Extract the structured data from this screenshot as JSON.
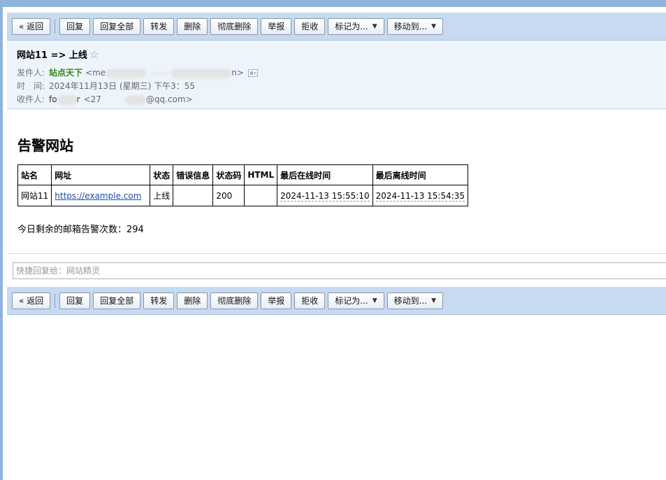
{
  "toolbar": {
    "back": "« 返回",
    "reply": "回复",
    "reply_all": "回复全部",
    "forward": "转发",
    "delete": "删除",
    "delete_permanently": "彻底删除",
    "report": "举报",
    "reject": "拒收",
    "mark_as": "标记为...",
    "move_to": "移动到..."
  },
  "email": {
    "subject": "网站11 => 上线",
    "star": "☆",
    "from_label": "发件人:",
    "from_name": "站点天下",
    "from_addr_start": "<me",
    "from_addr_end": "n>",
    "time_label": "时　间:",
    "time_value": "2024年11月13日 (星期三) 下午3：55",
    "to_label": "收件人:",
    "to_name_start": "fo",
    "to_name_end": "r",
    "to_addr_start": "<27",
    "to_addr_end": "@qq.com>"
  },
  "body": {
    "title": "告警网站",
    "table": {
      "headers": [
        "站名",
        "网址",
        "状态",
        "错误信息",
        "状态码",
        "HTML",
        "最后在线时间",
        "最后离线时间"
      ],
      "rows": [
        [
          "网站11",
          "https://example.com",
          "上线",
          "",
          "200",
          "",
          "2024-11-13 15:55:10",
          "2024-11-13 15:54:35"
        ]
      ]
    },
    "remaining": "今日剩余的邮箱告警次数：294"
  },
  "quick_reply": {
    "placeholder": "快捷回复给：网站精灵"
  },
  "colors": {
    "toolbar_bg": "#c7daf2",
    "header_bg": "#eef4fc",
    "sender_green": "#2a8a0c",
    "link_blue": "#1a4fa6",
    "frame_blue": "#8fb4dc"
  }
}
